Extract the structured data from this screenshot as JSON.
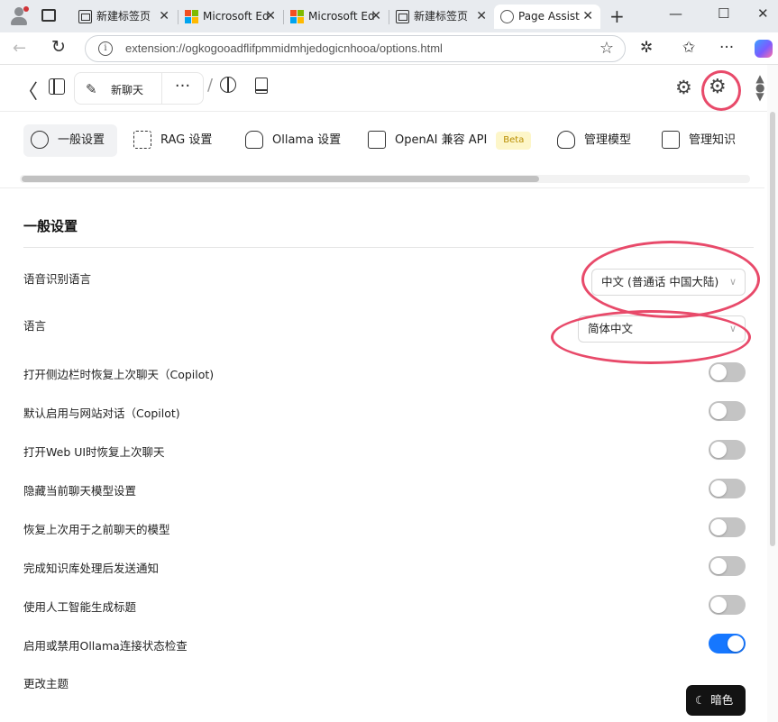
{
  "browser": {
    "tabs": [
      {
        "label": "新建标签页",
        "icon": "newtab-icon"
      },
      {
        "label": "Microsoft Ed",
        "icon": "microsoft-icon"
      },
      {
        "label": "Microsoft Ed",
        "icon": "microsoft-icon"
      },
      {
        "label": "新建标签页",
        "icon": "newtab-icon"
      },
      {
        "label": "Page Assist",
        "icon": "chat-icon",
        "active": true
      }
    ],
    "url": "extension://ogkogooadflifpmmidmhjedogicnhooa/options.html",
    "microsoft_colors": [
      "#f25022",
      "#7fba00",
      "#00a4ef",
      "#ffb900"
    ]
  },
  "header": {
    "new_chat_label": "新聊天"
  },
  "nav": {
    "items": [
      {
        "label": "一般设置",
        "active": true
      },
      {
        "label": "RAG 设置"
      },
      {
        "label": "Ollama 设置"
      },
      {
        "label": "OpenAI 兼容 API",
        "badge": "Beta"
      },
      {
        "label": "管理模型"
      },
      {
        "label": "管理知识"
      }
    ]
  },
  "general": {
    "title": "一般设置",
    "speech_language": {
      "label": "语音识别语言",
      "value": "中文 (普通话 中国大陆)"
    },
    "language": {
      "label": "语言",
      "value": "简体中文"
    },
    "toggles": [
      {
        "label": "打开侧边栏时恢复上次聊天（Copilot)",
        "on": false
      },
      {
        "label": "默认启用与网站对话（Copilot)",
        "on": false
      },
      {
        "label": "打开Web UI时恢复上次聊天",
        "on": false
      },
      {
        "label": "隐藏当前聊天模型设置",
        "on": false
      },
      {
        "label": "恢复上次用于之前聊天的模型",
        "on": false
      },
      {
        "label": "完成知识库处理后发送通知",
        "on": false
      },
      {
        "label": "使用人工智能生成标题",
        "on": false
      },
      {
        "label": "启用或禁用Ollama连接状态检查",
        "on": true
      }
    ],
    "theme": {
      "label": "更改主题",
      "button": "暗色"
    }
  },
  "colors": {
    "accent": "#1677ff",
    "annotation": "#e84a6a",
    "beta_bg": "#fdf6c9"
  }
}
